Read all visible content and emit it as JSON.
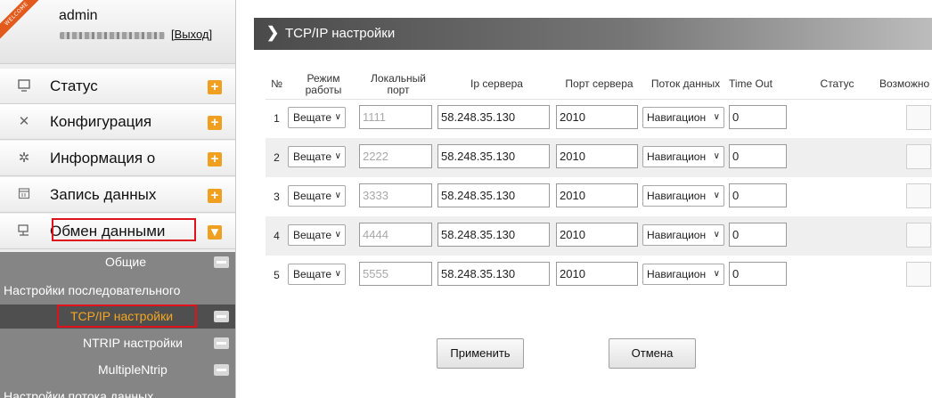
{
  "user": {
    "welcome": "WELCOME",
    "name": "admin",
    "logout": "[Выход]"
  },
  "sidebar": {
    "items": [
      {
        "label": "Статус",
        "icon": "monitor-icon"
      },
      {
        "label": "Конфигурация",
        "icon": "tools-icon"
      },
      {
        "label": "Информация о",
        "icon": "satellite-icon"
      },
      {
        "label": "Запись данных",
        "icon": "calendar-icon"
      },
      {
        "label": "Обмен данными",
        "icon": "network-icon"
      }
    ],
    "submenu": [
      {
        "label": "Общие"
      },
      {
        "label": "Настройки последовательного"
      },
      {
        "label": "TCP/IP настройки"
      },
      {
        "label": "NTRIP настройки"
      },
      {
        "label": "MultipleNtrip"
      },
      {
        "label": "Настройки потока данных"
      }
    ]
  },
  "main": {
    "chevron": "❯",
    "title": "TCP/IP настройки",
    "headers": {
      "num": "№",
      "mode": "Режим\nработы",
      "local": "Локальный\nпорт",
      "ip": "Ip сервера",
      "port": "Порт сервера",
      "flow": "Поток данных",
      "timeout": "Time Out",
      "status": "Статус",
      "enable": "Возможно"
    },
    "rows": [
      {
        "num": "1",
        "mode": "Вещате",
        "local_port": "1111",
        "ip": "58.248.35.130",
        "port": "2010",
        "flow": "Навигацион",
        "timeout": "0",
        "status": ""
      },
      {
        "num": "2",
        "mode": "Вещате",
        "local_port": "2222",
        "ip": "58.248.35.130",
        "port": "2010",
        "flow": "Навигацион",
        "timeout": "0",
        "status": ""
      },
      {
        "num": "3",
        "mode": "Вещате",
        "local_port": "3333",
        "ip": "58.248.35.130",
        "port": "2010",
        "flow": "Навигацион",
        "timeout": "0",
        "status": ""
      },
      {
        "num": "4",
        "mode": "Вещате",
        "local_port": "4444",
        "ip": "58.248.35.130",
        "port": "2010",
        "flow": "Навигацион",
        "timeout": "0",
        "status": ""
      },
      {
        "num": "5",
        "mode": "Вещате",
        "local_port": "5555",
        "ip": "58.248.35.130",
        "port": "2010",
        "flow": "Навигацион",
        "timeout": "0",
        "status": ""
      }
    ],
    "apply_label": "Применить",
    "cancel_label": "Отмена"
  },
  "colors": {
    "accent_orange": "#f0a020",
    "active_text": "#f5a623",
    "highlight_red": "#e0121c",
    "header_bar": "#4a4a4a",
    "submenu_bg": "#858585"
  }
}
